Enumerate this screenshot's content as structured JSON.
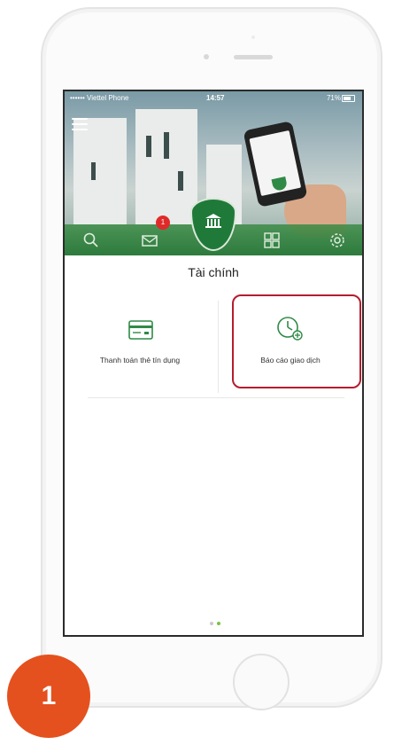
{
  "status_bar": {
    "carrier": "•••••• Viettel Phone",
    "time": "14:57",
    "battery": "71%"
  },
  "nav": {
    "notification_count": "1",
    "items": [
      "search-icon",
      "mail-icon",
      "bank-icon",
      "grid-icon",
      "gear-icon"
    ]
  },
  "content": {
    "section_title": "Tài chính",
    "tiles": [
      {
        "label": "Thanh toán thẻ tín dụng",
        "icon": "credit-card-icon"
      },
      {
        "label": "Báo cáo giao dịch",
        "icon": "clock-report-icon"
      }
    ]
  },
  "step": {
    "number": "1"
  },
  "colors": {
    "brand_green": "#1f7a3a",
    "highlight_red": "#b51d2c",
    "step_orange": "#e4511e",
    "dot_active": "#7cc243",
    "dot_inactive": "#c9c9c9"
  }
}
